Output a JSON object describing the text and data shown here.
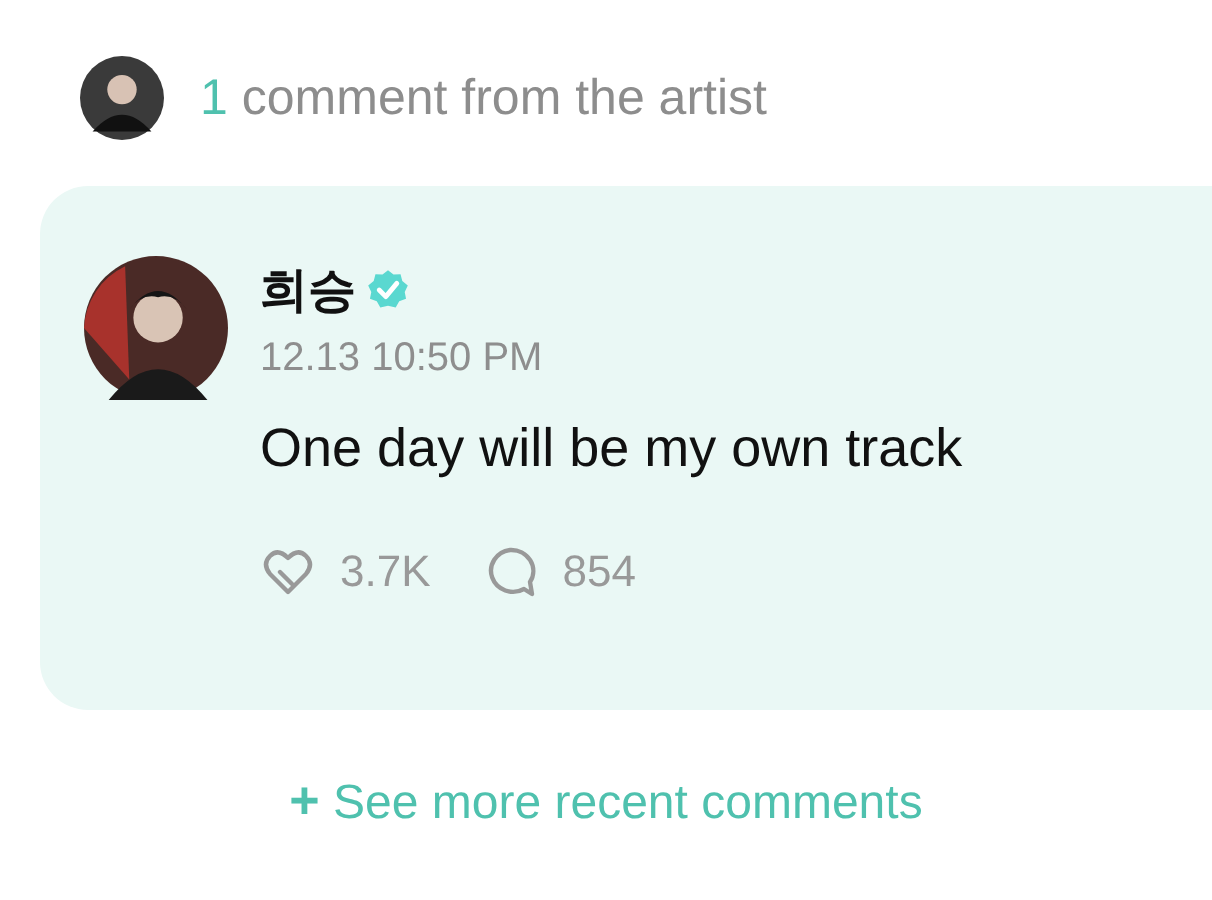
{
  "header": {
    "count": "1",
    "text": "comment from the artist"
  },
  "comment": {
    "author": "희승",
    "verified": true,
    "time": "12.13 10:50 PM",
    "text": "One day will be my own track",
    "likes": "3.7K",
    "replies": "854"
  },
  "more_link": {
    "icon": "+",
    "label": "See more recent comments"
  }
}
